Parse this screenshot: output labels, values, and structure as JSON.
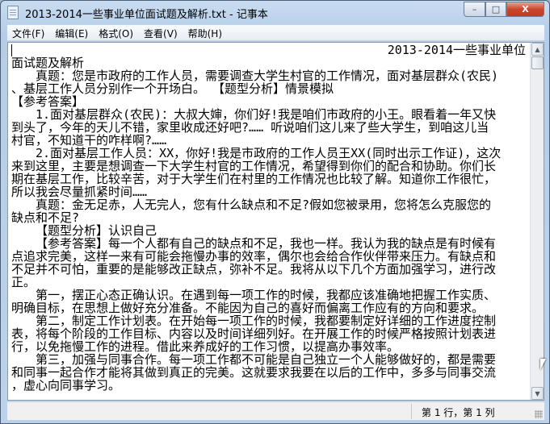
{
  "window": {
    "title": "2013-2014一些事业单位面试题及解析.txt - 记事本",
    "minimize": "–",
    "maximize": "□",
    "close": "X"
  },
  "menu": [
    "文件(F)",
    "编辑(E)",
    "格式(O)",
    "查看(V)",
    "帮助(H)"
  ],
  "lines": [
    {
      "t": "2013-2014一些事业单位",
      "s": "r"
    },
    {
      "t": "面试题及解析",
      "s": ""
    },
    {
      "t": "真题：您是市政府的工作人员，需要调查大学生村官的工作情况，面对基层群众(农民)",
      "s": "i"
    },
    {
      "t": "、基层工作人员分别作一个开场白。 【题型分析】情景模拟",
      "s": ""
    },
    {
      "t": "【参考答案】",
      "s": ""
    },
    {
      "t": "1.面对基层群众(农民)：大叔大婶，你们好!我是咱们市政府的小王。眼看着一年又快",
      "s": "i"
    },
    {
      "t": "到头了，今年的天儿不错，家里收成还好吧?…… 听说咱们这儿来了些大学生，到咱这儿当",
      "s": ""
    },
    {
      "t": "村官，不知道干的咋样啊?……",
      "s": ""
    },
    {
      "t": "2.面对基层工作人员：XX，你好!我是市政府的工作人员王XX(同时出示工作证)，这次",
      "s": "i"
    },
    {
      "t": "来到这里，主要是想调查一下大学生村官的工作情况，希望得到你们的配合和协助。你们长",
      "s": ""
    },
    {
      "t": "期在基层工作，比较辛苦，对于大学生们在村里的工作情况也比较了解。知道你工作很忙，",
      "s": ""
    },
    {
      "t": "所以我会尽量抓紧时间……",
      "s": ""
    },
    {
      "t": "真题：金无足赤，人无完人，您有什么缺点和不足?假如您被录用，您将怎么克服您的",
      "s": "i"
    },
    {
      "t": "缺点和不足?",
      "s": ""
    },
    {
      "t": "【题型分析】认识自己",
      "s": "i"
    },
    {
      "t": "【参考答案】每一个人都有自己的缺点和不足，我也一样。我认为我的缺点是有时候有",
      "s": "i"
    },
    {
      "t": "点追求完美，这样一来有可能会拖慢办事的效率，偶尔也会给合作伙伴带来压力。有缺点和",
      "s": ""
    },
    {
      "t": "不足并不可怕，重要的是能够改正缺点，弥补不足。我将从以下几个方面加强学习，进行改",
      "s": ""
    },
    {
      "t": "正。",
      "s": ""
    },
    {
      "t": "第一，摆正心态正确认识。在遇到每一项工作的时候，我都应该准确地把握工作实质、",
      "s": "i"
    },
    {
      "t": "明确目标，在思想上做好充分准备。不能因为自己的喜好而偏离工作应有的方向和要求。",
      "s": ""
    },
    {
      "t": "第二，制定工作计划表。在开始每一项工作的时候，我都要制定好详细的工作进度控制",
      "s": "i"
    },
    {
      "t": "表，将每个阶段的工作目标、内容以及时间详细列好。在开展工作的时候严格按照计划表进",
      "s": ""
    },
    {
      "t": "行，以免拖慢工作的进程。借此来养成好的工作习惯，以提高办事效率。",
      "s": ""
    },
    {
      "t": "第三，加强与同事合作。每一项工作都不可能是自己独立一个人能够做好的，都是需要",
      "s": "i"
    },
    {
      "t": "和同事一起合作才能将其做到真正的完美。这就要求我要在以后的工作中，多多与同事交流",
      "s": ""
    },
    {
      "t": "，虚心向同事学习。",
      "s": ""
    }
  ],
  "scroll": {
    "up": "▲",
    "down": "▼",
    "position_fraction": 0
  },
  "status": {
    "position": "第 1 行，第 1 列"
  }
}
